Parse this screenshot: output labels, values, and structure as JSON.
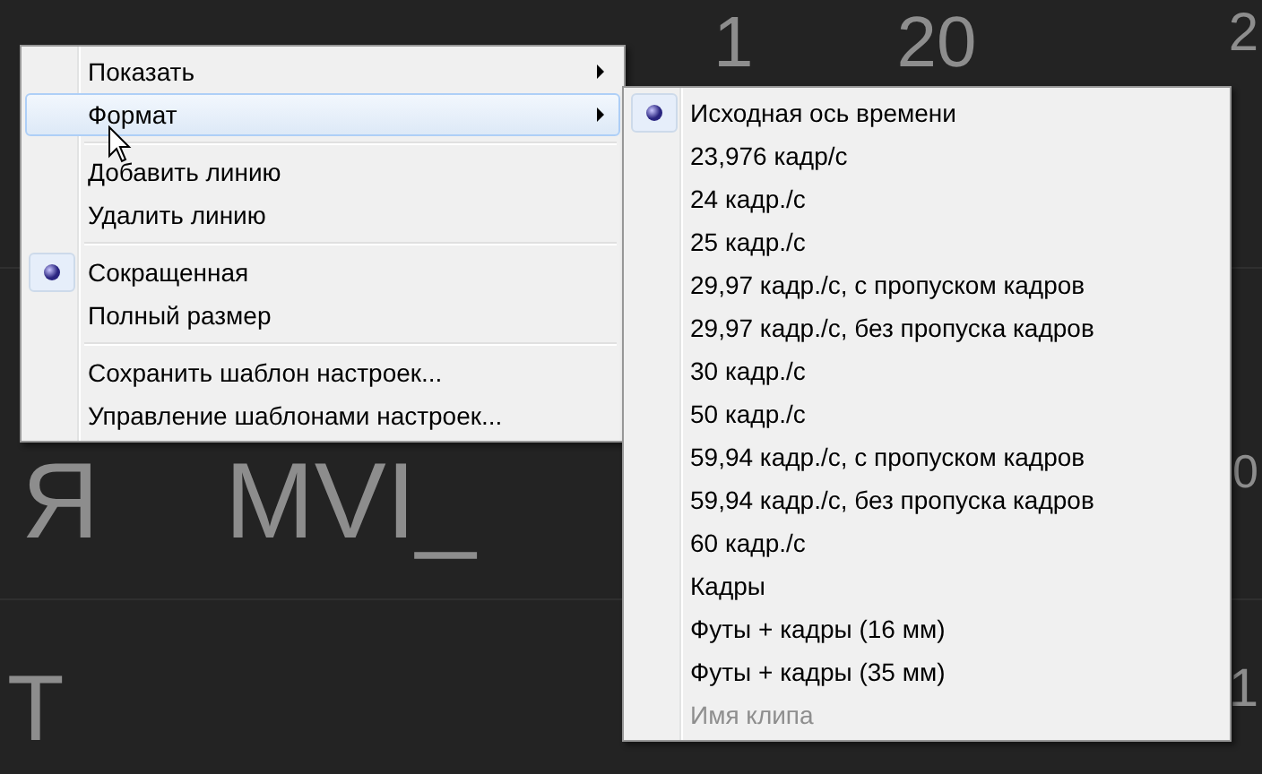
{
  "background": {
    "rows": [
      {
        "fragments": [
          "1",
          "20",
          "2"
        ]
      },
      {
        "fragments": [
          "Я",
          "MVI_",
          "0"
        ]
      },
      {
        "fragments": [
          "Т",
          "1"
        ]
      }
    ]
  },
  "menu": {
    "items": [
      {
        "kind": "item",
        "label": "Показать",
        "has_submenu": true,
        "selected": false,
        "checked": false
      },
      {
        "kind": "item",
        "label": "Формат",
        "has_submenu": true,
        "selected": true,
        "checked": false
      },
      {
        "kind": "separator"
      },
      {
        "kind": "item",
        "label": "Добавить линию",
        "has_submenu": false,
        "selected": false,
        "checked": false
      },
      {
        "kind": "item",
        "label": "Удалить линию",
        "has_submenu": false,
        "selected": false,
        "checked": false
      },
      {
        "kind": "separator"
      },
      {
        "kind": "item",
        "label": "Сокращенная",
        "has_submenu": false,
        "selected": false,
        "checked": true
      },
      {
        "kind": "item",
        "label": "Полный размер",
        "has_submenu": false,
        "selected": false,
        "checked": false
      },
      {
        "kind": "separator"
      },
      {
        "kind": "item",
        "label": "Сохранить шаблон настроек...",
        "has_submenu": false,
        "selected": false,
        "checked": false
      },
      {
        "kind": "item",
        "label": "Управление шаблонами настроек...",
        "has_submenu": false,
        "selected": false,
        "checked": false
      }
    ]
  },
  "submenu": {
    "items": [
      {
        "label": "Исходная ось времени",
        "checked": true,
        "disabled": false
      },
      {
        "label": "23,976 кадр/с",
        "checked": false,
        "disabled": false
      },
      {
        "label": "24 кадр./с",
        "checked": false,
        "disabled": false
      },
      {
        "label": "25 кадр./с",
        "checked": false,
        "disabled": false
      },
      {
        "label": "29,97 кадр./с, с пропуском кадров",
        "checked": false,
        "disabled": false
      },
      {
        "label": "29,97 кадр./с, без пропуска кадров",
        "checked": false,
        "disabled": false
      },
      {
        "label": "30 кадр./с",
        "checked": false,
        "disabled": false
      },
      {
        "label": "50 кадр./с",
        "checked": false,
        "disabled": false
      },
      {
        "label": "59,94 кадр./с, с пропуском кадров",
        "checked": false,
        "disabled": false
      },
      {
        "label": "59,94 кадр./с, без пропуска кадров",
        "checked": false,
        "disabled": false
      },
      {
        "label": "60 кадр./с",
        "checked": false,
        "disabled": false
      },
      {
        "label": "Кадры",
        "checked": false,
        "disabled": false
      },
      {
        "label": "Футы + кадры (16 мм)",
        "checked": false,
        "disabled": false
      },
      {
        "label": "Футы + кадры (35 мм)",
        "checked": false,
        "disabled": false
      },
      {
        "label": "Имя клипа",
        "checked": false,
        "disabled": true
      }
    ]
  }
}
